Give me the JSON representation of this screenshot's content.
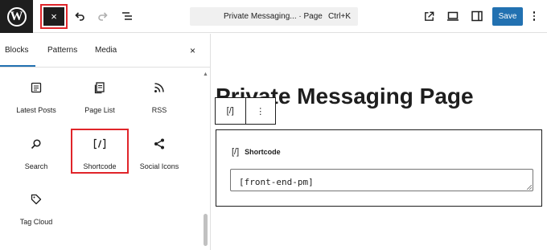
{
  "topbar": {
    "logo_letter": "W",
    "close_icon": "×",
    "command_title": "Private Messaging... · Page",
    "command_shortcut": "Ctrl+K",
    "save_label": "Save"
  },
  "sidebar": {
    "tabs": [
      {
        "label": "Blocks",
        "active": true
      },
      {
        "label": "Patterns",
        "active": false
      },
      {
        "label": "Media",
        "active": false
      }
    ],
    "close_icon": "×",
    "blocks": [
      {
        "label": "Latest Posts",
        "icon": "latest-posts-icon"
      },
      {
        "label": "Page List",
        "icon": "page-list-icon"
      },
      {
        "label": "RSS",
        "icon": "rss-icon"
      },
      {
        "label": "Search",
        "icon": "search-icon"
      },
      {
        "label": "Shortcode",
        "icon": "shortcode-icon",
        "highlighted": true
      },
      {
        "label": "Social Icons",
        "icon": "share-icon"
      },
      {
        "label": "Tag Cloud",
        "icon": "tag-icon"
      }
    ]
  },
  "editor": {
    "page_title": "Private Messaging Page",
    "toolbar_block_icon": "[/]",
    "toolbar_more_icon": "⋮",
    "shortcode_block": {
      "label": "Shortcode",
      "icon": "[/]",
      "value": "[front-end-pm]"
    }
  },
  "colors": {
    "accent": "#2271b1",
    "highlight": "#e0252a",
    "dark": "#1e1e1e"
  }
}
